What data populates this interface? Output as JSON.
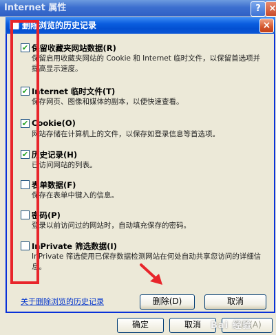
{
  "parent": {
    "title": "Internet 属性",
    "help_label": "?",
    "close_label": "×",
    "ok_label": "确定",
    "cancel_label": "取消",
    "apply_label": "应用(A)"
  },
  "dialog": {
    "title": "删除浏览的历史记录",
    "close_label": "×",
    "items": [
      {
        "label": "保留收藏夹网站数据(R)",
        "checked": true,
        "desc": "保留启用收藏夹网站的 Cookie 和 Internet 临时文件，以保留首选项并提高显示速度。"
      },
      {
        "label": "Internet 临时文件(T)",
        "checked": true,
        "desc": "保存网页、图像和媒体的副本，以便快速查看。"
      },
      {
        "label": "Cookie(O)",
        "checked": true,
        "desc": "网站存储在计算机上的文件，以保存如登录信息等首选项。"
      },
      {
        "label": "历史记录(H)",
        "checked": true,
        "desc": "已访问网站的列表。"
      },
      {
        "label": "表单数据(F)",
        "checked": false,
        "desc": "保存在表单中键入的信息。"
      },
      {
        "label": "密码(P)",
        "checked": false,
        "desc": "登录以前访问过的网站时，自动填充保存的密码。"
      },
      {
        "label": "InPrivate 筛选数据(I)",
        "checked": false,
        "desc": "InPrivate 筛选使用已保存数据检测网站在何处自动共享您访问的详细信息。"
      }
    ],
    "about_link": "关于删除浏览的历史记录",
    "delete_label": "删除(D)",
    "cancel_label": "取消",
    "check_mark": "✔"
  },
  "watermark": "Bai 经验",
  "colors": {
    "annotation_red": "#e8252b",
    "titlebar_blue": "#0a5ddf"
  }
}
